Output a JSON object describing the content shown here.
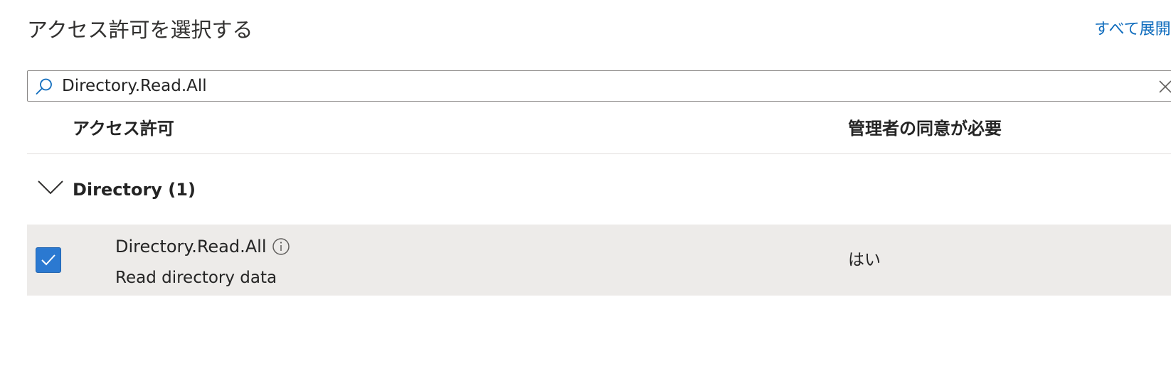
{
  "header": {
    "title": "アクセス許可を選択する",
    "expand_all_label": "すべて展開"
  },
  "search": {
    "value": "Directory.Read.All",
    "placeholder": ""
  },
  "table": {
    "columns": [
      "アクセス許可",
      "管理者の同意が必要"
    ],
    "groups": [
      {
        "label": "Directory (1)",
        "expanded": true,
        "rows": [
          {
            "name": "Directory.Read.All",
            "description": "Read directory data",
            "admin_consent_required": "はい",
            "checked": true
          }
        ]
      }
    ]
  },
  "icons": {
    "search": "search-icon",
    "clear": "close-icon",
    "group_toggle": "chevron-down-icon",
    "info": "info-icon",
    "checkbox": "check-icon"
  },
  "colors": {
    "accent": "#0f6cbd",
    "checkbox_fill": "#2b79d1",
    "selected_row": "#edebe9",
    "divider": "#e1dfdd"
  }
}
